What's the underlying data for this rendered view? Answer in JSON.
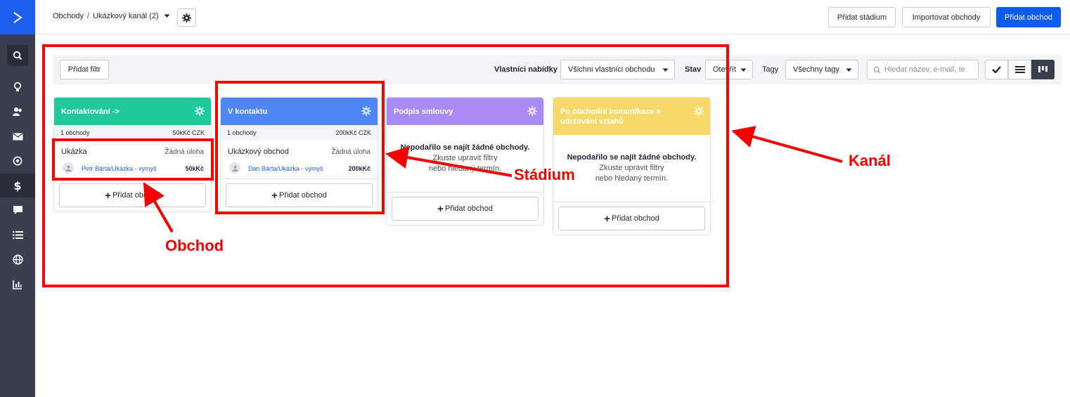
{
  "header": {
    "breadcrumb_root": "Obchody",
    "breadcrumb_sep": "/",
    "breadcrumb_pipeline": "Ukázkový kanál (2)",
    "btn_add_stage": "Přidat stádium",
    "btn_import": "Importovat obchody",
    "btn_add_deal": "Přidat obchod"
  },
  "sidebar": {
    "items": [
      "search-icon",
      "lightbulb-icon",
      "contacts-icon",
      "mail-icon",
      "target-icon",
      "dollar-icon",
      "chat-icon",
      "list-icon",
      "globe-icon",
      "chart-icon"
    ],
    "active": "dollar-icon"
  },
  "filters": {
    "add_filter": "Přidat filtr",
    "owner_label": "Vlastníci nabídky",
    "owner_value": "Všichni vlastníci obchodu",
    "status_label": "Stav",
    "status_value": "Otevřít",
    "tags_label": "Tagy",
    "tags_value": "Všechny tagy",
    "search_placeholder": "Hledat název, e-mail, te"
  },
  "stages": [
    {
      "title": "Kontaktování ->",
      "color": "#1fc99a",
      "count": "1 obchody",
      "total": "50kKč CZK",
      "deal": {
        "name": "Ukázka",
        "task": "Žádná úloha",
        "contact": "Petr Bárta/Ukázka - vymyš",
        "value": "50kKč"
      },
      "add_label": "Přidat obchod"
    },
    {
      "title": "V kontaktu",
      "color": "#4f86f7",
      "count": "1 obchody",
      "total": "200kKč CZK",
      "deal": {
        "name": "Ukázkový obchod",
        "task": "Žádná úloha",
        "contact": "Dan Bárta/Ukázka - vymyš",
        "value": "200kKč"
      },
      "add_label": "Přidat obchod"
    },
    {
      "title": "Podpis smlouvy",
      "color": "#a98bf5",
      "empty_title": "Nepodařilo se najít žádné obchody.",
      "empty_line1": "Zkuste upravit filtry",
      "empty_line2": "nebo hledaný termín.",
      "add_label": "Přidat obchod"
    },
    {
      "title": "Po obchodní komunikace a udržování vztahů",
      "color": "#f7d96a",
      "empty_title": "Nepodařilo se najít žádné obchody.",
      "empty_line1": "Zkuste upravit filtry",
      "empty_line2": "nebo hledaný termín.",
      "add_label": "Přidat obchod"
    }
  ],
  "annotations": {
    "stage_label": "Stádium",
    "pipeline_label": "Kanál",
    "deal_label": "Obchod",
    "color": "#f20000"
  }
}
